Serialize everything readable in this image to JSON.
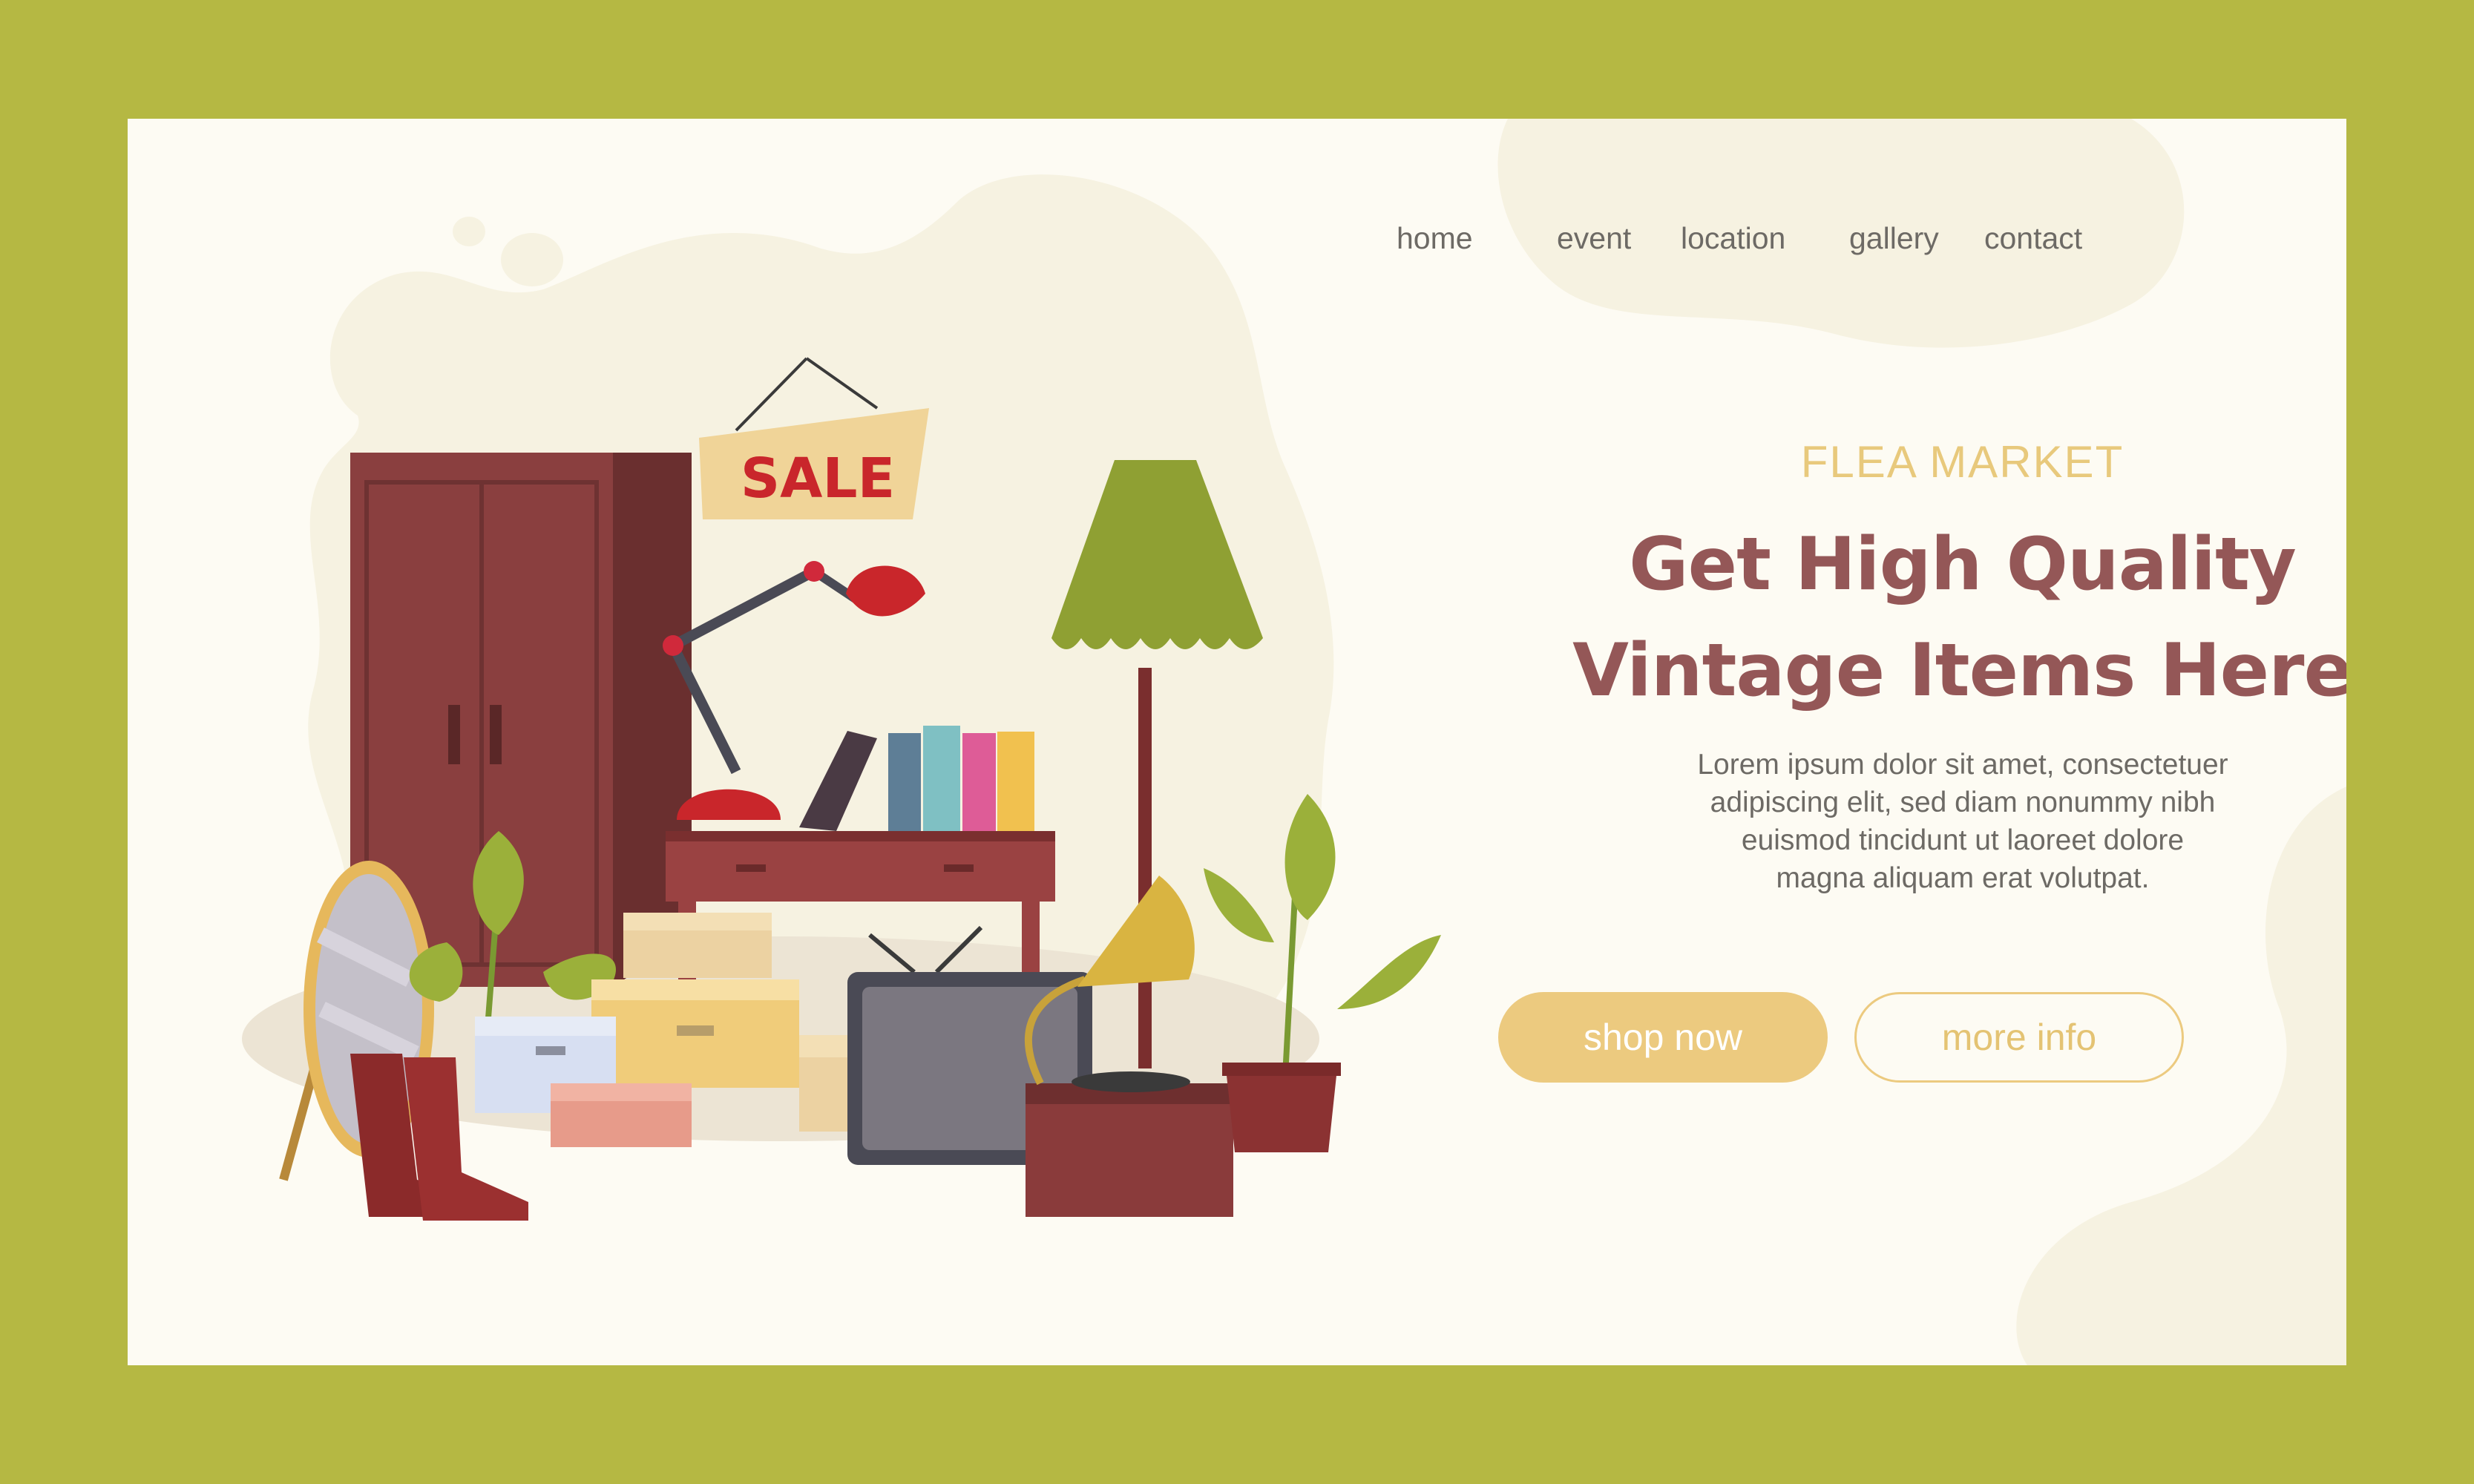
{
  "nav": {
    "items": [
      "home",
      "event",
      "location",
      "gallery",
      "contact"
    ]
  },
  "hero": {
    "eyebrow": "FLEA MARKET",
    "headline_line1": "Get High Quality",
    "headline_line2": "Vintage Items Here",
    "body_lines": [
      "Lorem ipsum dolor sit amet, consectetuer",
      "adipiscing elit, sed diam nonummy nibh",
      "euismod tincidunt ut laoreet dolore",
      "magna aliquam erat volutpat."
    ]
  },
  "buttons": {
    "primary_label": "shop now",
    "secondary_label": "more info"
  },
  "illustration": {
    "sign_text": "SALE"
  },
  "colors": {
    "frame": "#b5b843",
    "card": "#fdfbf3",
    "blob": "#f6f2e1",
    "accent": "#ecca7f",
    "headline": "#945757",
    "text": "#6d6a65"
  }
}
